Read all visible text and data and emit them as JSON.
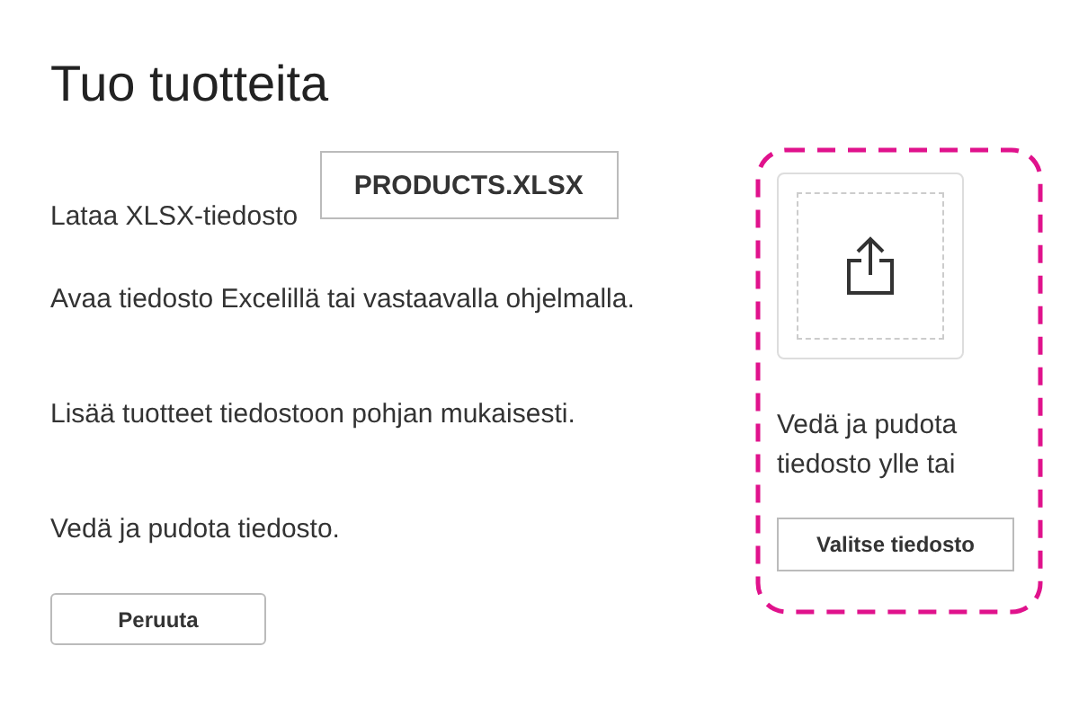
{
  "title": "Tuo tuotteita",
  "steps": [
    {
      "text": "Lataa XLSX-tiedosto",
      "button": "PRODUCTS.XLSX"
    },
    {
      "text": "Avaa tiedosto Excelillä tai vastaavalla ohjelmalla."
    },
    {
      "text": "Lisää tuotteet tiedostoon pohjan mukaisesti."
    },
    {
      "text": "Vedä ja pudota tiedosto."
    }
  ],
  "cancel_button": "Peruuta",
  "dropzone": {
    "text": "Vedä ja pudota tiedosto ylle tai",
    "button": "Valitse tiedosto"
  }
}
